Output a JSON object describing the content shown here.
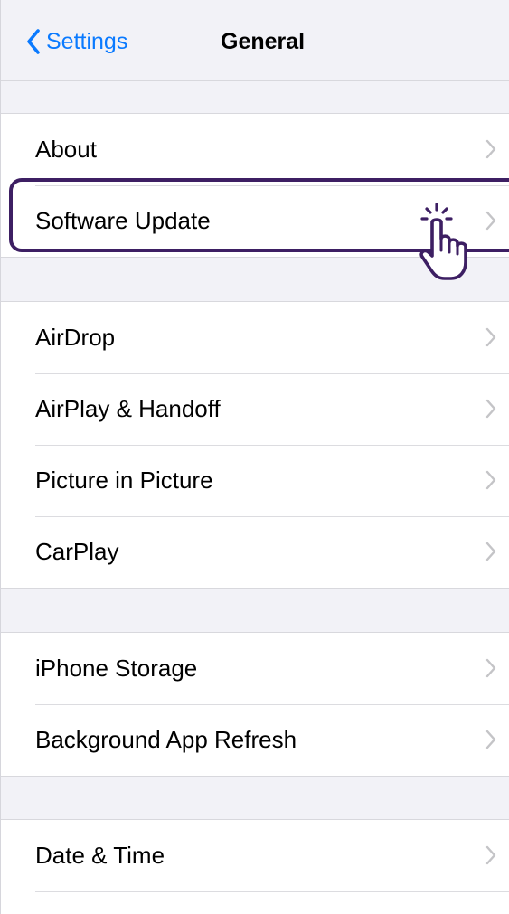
{
  "navbar": {
    "back_label": "Settings",
    "title": "General",
    "accent_color": "#0a7aff"
  },
  "groups": [
    {
      "items": [
        {
          "label": "About"
        },
        {
          "label": "Software Update"
        }
      ]
    },
    {
      "items": [
        {
          "label": "AirDrop"
        },
        {
          "label": "AirPlay & Handoff"
        },
        {
          "label": "Picture in Picture"
        },
        {
          "label": "CarPlay"
        }
      ]
    },
    {
      "items": [
        {
          "label": "iPhone Storage"
        },
        {
          "label": "Background App Refresh"
        }
      ]
    },
    {
      "items": [
        {
          "label": "Date & Time"
        }
      ]
    }
  ],
  "highlight": {
    "target": "Software Update",
    "color": "#3d1f63",
    "pointer_icon": "hand-tap-icon"
  }
}
